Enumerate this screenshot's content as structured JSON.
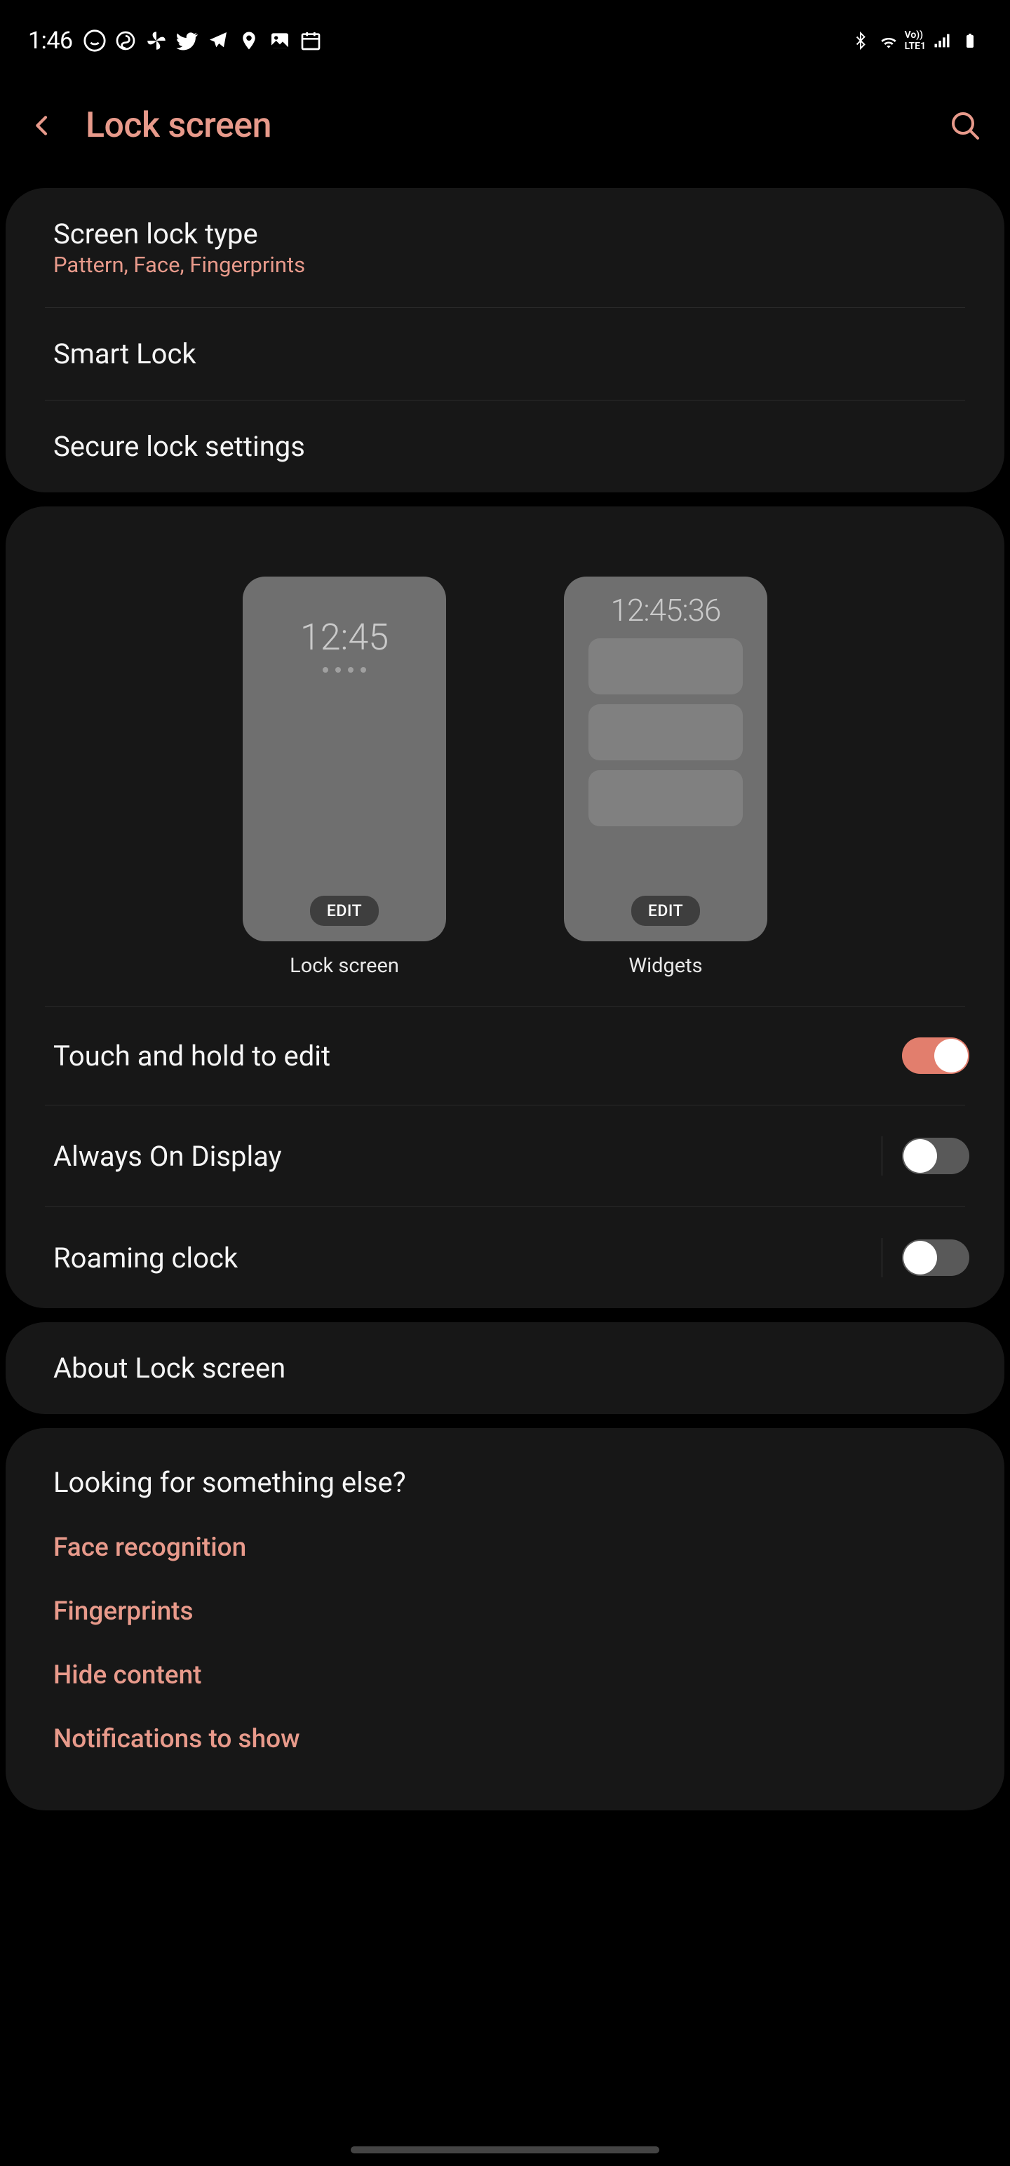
{
  "status": {
    "time": "1:46",
    "right_icons": [
      "bluetooth",
      "wifi",
      "volte",
      "signal",
      "battery"
    ]
  },
  "header": {
    "title": "Lock screen"
  },
  "group1": {
    "items": [
      {
        "title": "Screen lock type",
        "subtitle": "Pattern, Face, Fingerprints"
      },
      {
        "title": "Smart Lock"
      },
      {
        "title": "Secure lock settings"
      }
    ]
  },
  "previews": {
    "lock": {
      "time": "12:45",
      "edit": "EDIT",
      "label": "Lock screen"
    },
    "widgets": {
      "time": "12:45:36",
      "edit": "EDIT",
      "label": "Widgets"
    }
  },
  "toggles": {
    "touch_hold": {
      "title": "Touch and hold to edit",
      "state": "on"
    },
    "aod": {
      "title": "Always On Display",
      "state": "off"
    },
    "roaming": {
      "title": "Roaming clock",
      "state": "off"
    }
  },
  "group3": {
    "about": "About Lock screen"
  },
  "looking": {
    "title": "Looking for something else?",
    "links": [
      "Face recognition",
      "Fingerprints",
      "Hide content",
      "Notifications to show"
    ]
  }
}
